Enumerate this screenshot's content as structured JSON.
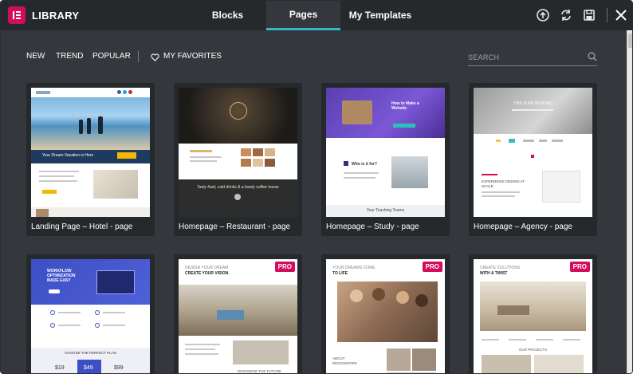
{
  "header": {
    "title": "LIBRARY",
    "tabs": [
      {
        "label": "Blocks"
      },
      {
        "label": "Pages",
        "active": true
      },
      {
        "label": "My Templates"
      }
    ],
    "icons": [
      "upload-icon",
      "sync-icon",
      "save-icon",
      "close-icon"
    ]
  },
  "filters": {
    "new": "NEW",
    "trend": "TREND",
    "popular": "POPULAR",
    "favorites": "MY FAVORITES"
  },
  "search": {
    "placeholder": "SEARCH"
  },
  "colors": {
    "accent": "#39b7c8",
    "brand": "#d30c5c",
    "background": "#34383c",
    "header": "#26292c"
  },
  "templates": [
    {
      "title": "Landing Page – Hotel - page",
      "pro": false
    },
    {
      "title": "Homepage – Restaurant - page",
      "pro": false
    },
    {
      "title": "Homepage – Study - page",
      "pro": false
    },
    {
      "title": "Homepage – Agency - page",
      "pro": false
    },
    {
      "title": "",
      "pro": false
    },
    {
      "title": "",
      "pro": true,
      "badge": "PRO"
    },
    {
      "title": "",
      "pro": true,
      "badge": "PRO"
    },
    {
      "title": "",
      "pro": true,
      "badge": "PRO"
    }
  ],
  "thumbs": {
    "hotel": {
      "tagline": "Your Dream Vacation is Here"
    },
    "restaurant": {
      "script": "Tasty food, cold drinks & a lovely coffee house"
    },
    "study": {
      "heading": "How to Make a Website",
      "who": "Who is it for?",
      "teams": "Your Teaching Teams"
    },
    "agency": {
      "heading": "THIS IS AN HEADING",
      "design": "EXPERIENCE DESIGN AT SCALE"
    },
    "workflow": {
      "heading": "WORKFLOW OPTIMIZATION MADE EASY",
      "plan": "CHOOSE THE PERFECT PLAN",
      "p1": "$19",
      "p2": "$49",
      "p3": "$99"
    },
    "dream": {
      "l1": "DESIGN YOUR DREAM",
      "l2": "CREATE YOUR VISION.",
      "future": "DESIGNING THE FUTURE"
    },
    "team": {
      "l1": "YOUR DREAMS COME",
      "l2": "TO LIFE",
      "about": "ABOUT DESIGNWORK"
    },
    "solutions": {
      "l1": "CREATE SOLUTIONS",
      "l2": "WITH A TWIST",
      "projects": "OUR PROJECTS"
    }
  }
}
